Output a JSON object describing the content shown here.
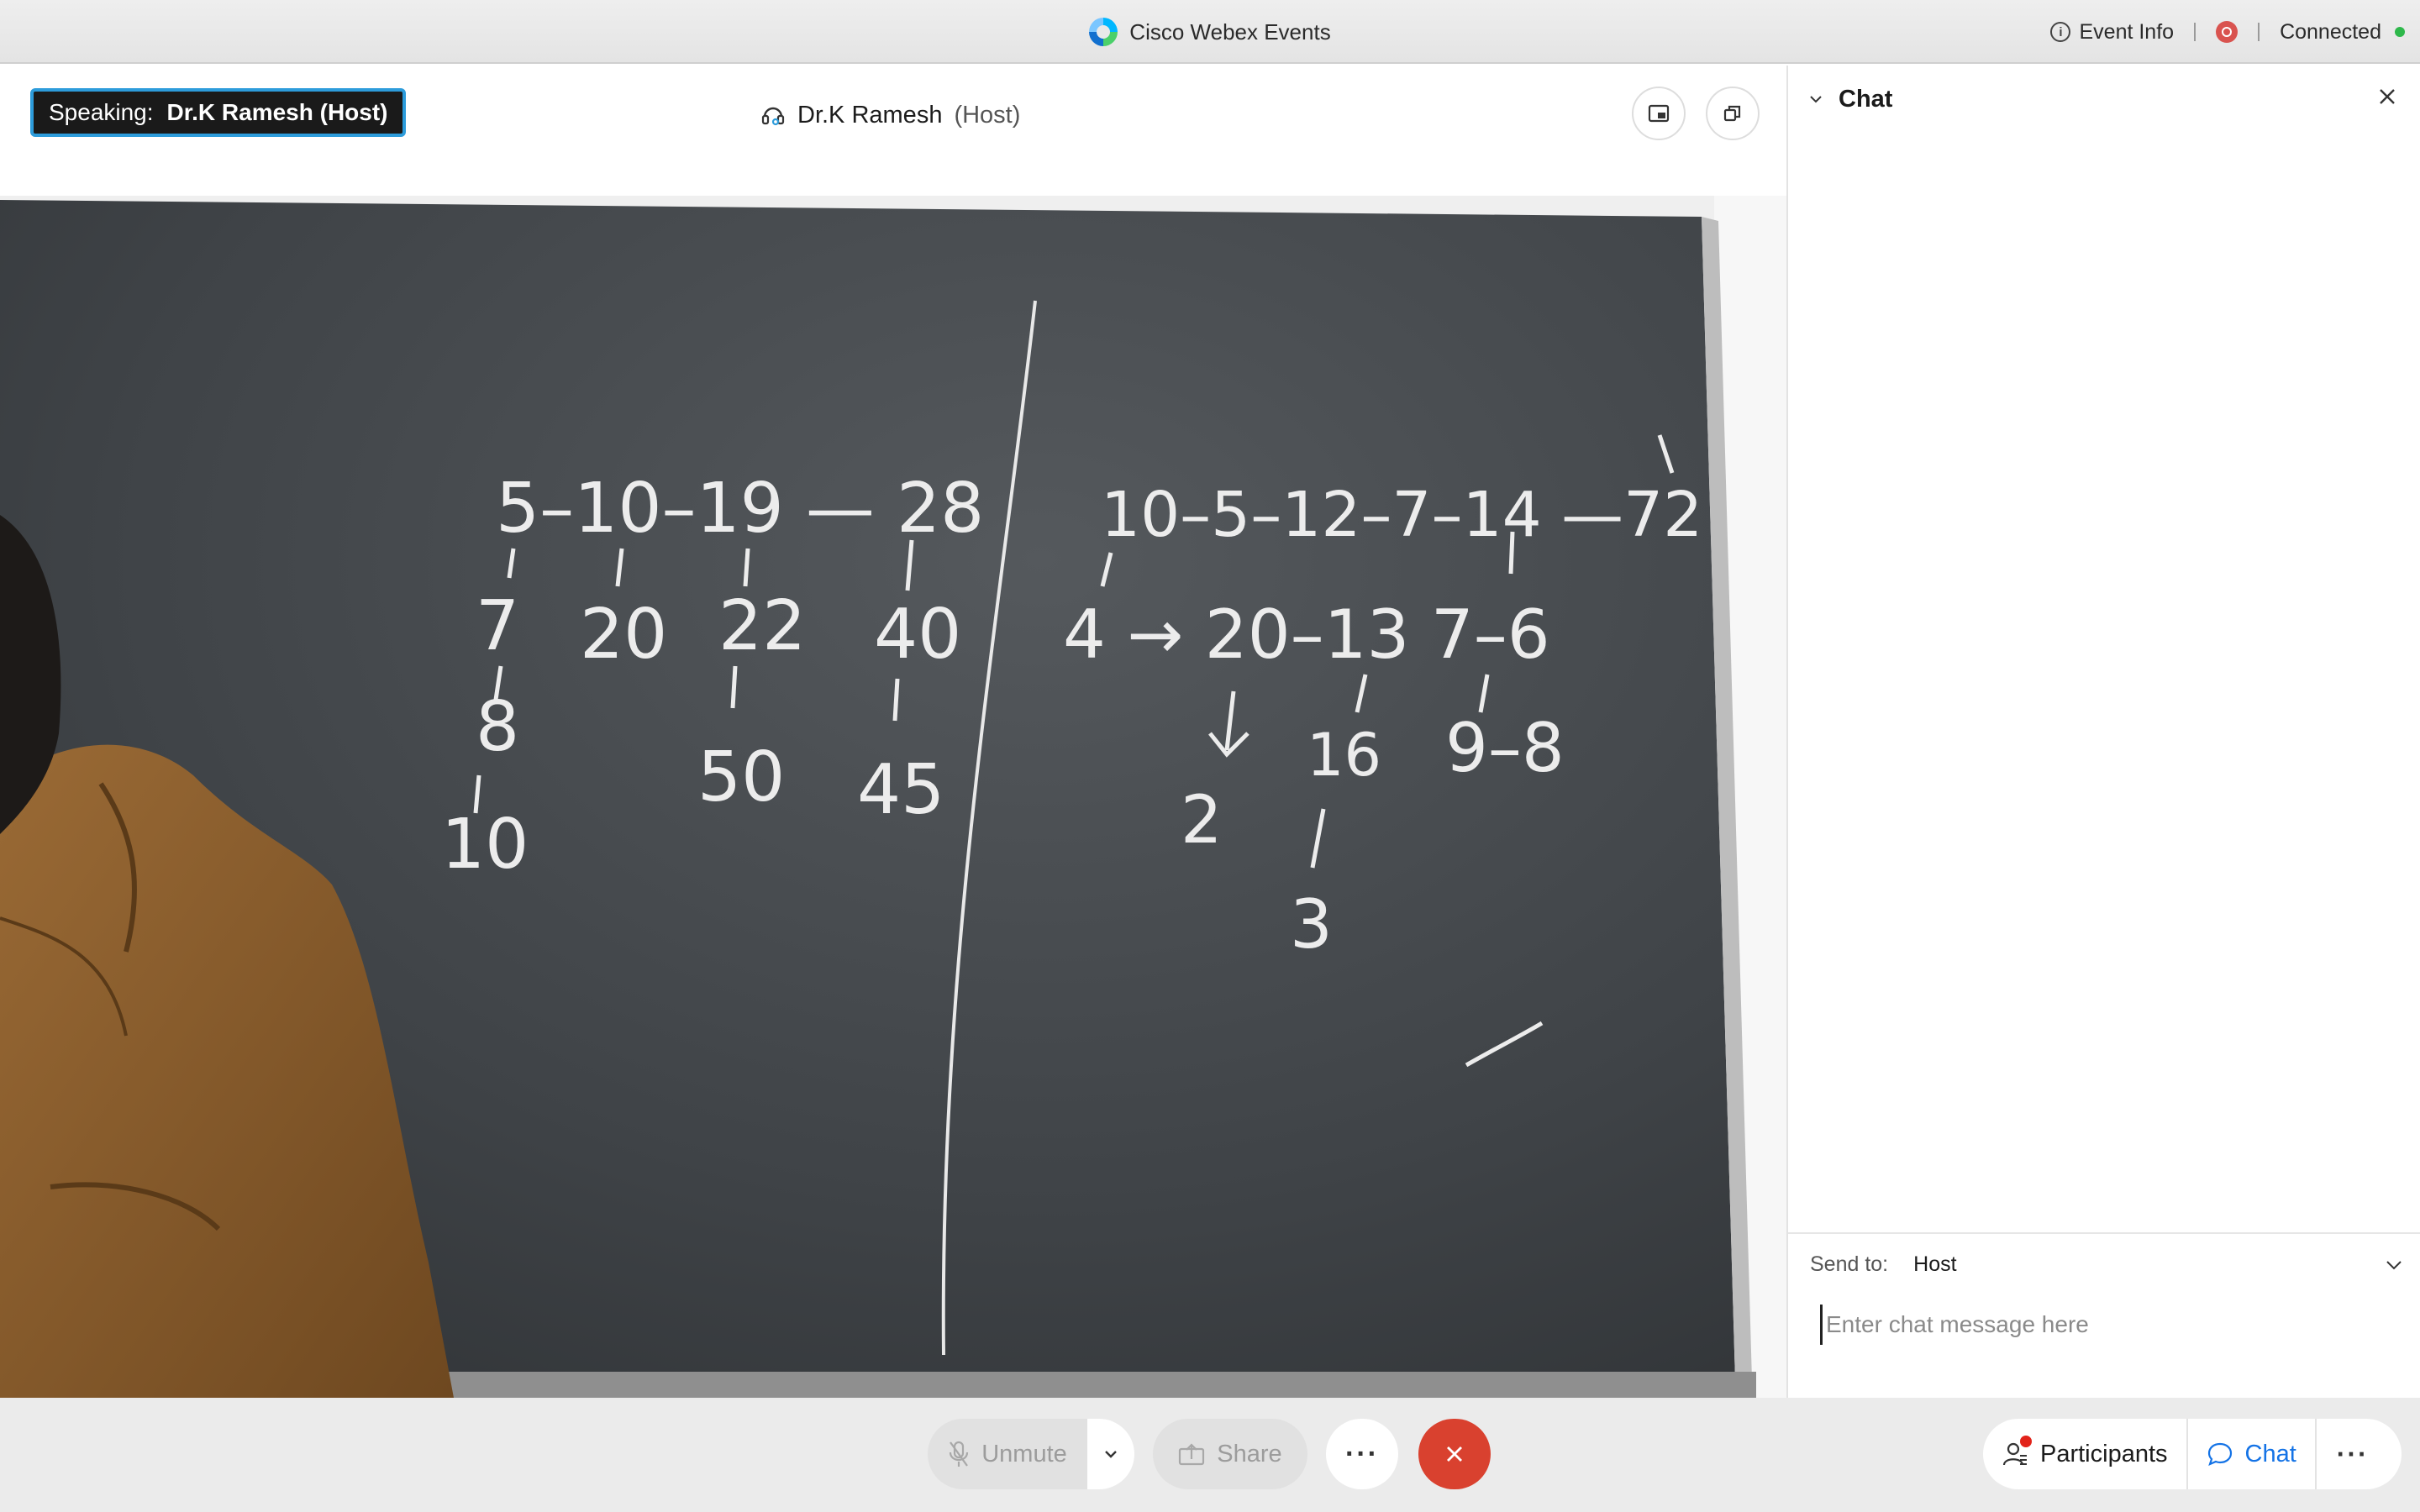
{
  "window": {
    "title": "Cisco Webex Events",
    "event_info_label": "Event Info",
    "connection_status": "Connected",
    "recording_icon": "record-icon",
    "status_color": "#2eb84b"
  },
  "stage": {
    "speaking_prefix": "Speaking:",
    "speaking_name": "Dr.K Ramesh (Host)",
    "active_speaker_name": "Dr.K Ramesh",
    "active_speaker_role": "(Host)",
    "buttons": [
      "picture-in-picture-icon",
      "pop-out-icon"
    ]
  },
  "blackboard": {
    "left_main_row": "5–10–19 — 28",
    "left_col1": [
      "7",
      "8",
      "10"
    ],
    "left_col2": [
      "20"
    ],
    "left_col3": [
      "22",
      "50"
    ],
    "left_col4": [
      "40",
      "45"
    ],
    "right_top_row": "10–5–12–7–14 —72",
    "right_row2": "4 → 20–13   7–6",
    "right_items": [
      "2",
      "16",
      "9–8",
      "3"
    ]
  },
  "chat": {
    "title": "Chat",
    "send_to_label": "Send to:",
    "send_to_value": "Host",
    "input_placeholder": "Enter chat message here"
  },
  "controls": {
    "unmute_label": "Unmute",
    "share_label": "Share",
    "more_label": "···",
    "participants_label": "Participants",
    "chat_label": "Chat",
    "more_right_label": "···",
    "leave_color": "#d9412f",
    "accent_color": "#1473e6"
  }
}
